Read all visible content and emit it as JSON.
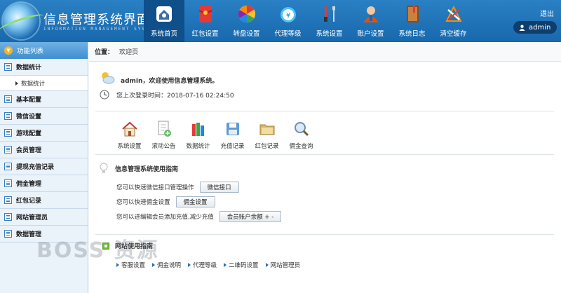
{
  "header": {
    "title": "信息管理系统界面",
    "subtitle": "INFORMATION MANAGEMENT SYSTEM GUI",
    "logout": "退出",
    "user": "admin",
    "nav": [
      {
        "label": "系统首页",
        "icon": "home-icon",
        "active": true
      },
      {
        "label": "红包设置",
        "icon": "red-envelope-icon",
        "active": false
      },
      {
        "label": "转盘设置",
        "icon": "wheel-icon",
        "active": false
      },
      {
        "label": "代理等级",
        "icon": "money-bag-icon",
        "active": false
      },
      {
        "label": "系统设置",
        "icon": "tools-icon",
        "active": false
      },
      {
        "label": "账户设置",
        "icon": "user-icon",
        "active": false
      },
      {
        "label": "系统日志",
        "icon": "book-icon",
        "active": false
      },
      {
        "label": "清空缓存",
        "icon": "cleanup-icon",
        "active": false
      }
    ]
  },
  "sidebar": {
    "header": "功能列表",
    "items": [
      {
        "label": "数据统计",
        "sub": [
          "数据统计"
        ]
      },
      {
        "label": "基本配置"
      },
      {
        "label": "微信设置"
      },
      {
        "label": "游戏配置"
      },
      {
        "label": "会员管理"
      },
      {
        "label": "提现充值记录"
      },
      {
        "label": "佣金管理"
      },
      {
        "label": "红包记录"
      },
      {
        "label": "网站管理员"
      },
      {
        "label": "数据管理"
      }
    ]
  },
  "breadcrumb": {
    "label": "位置：",
    "current": "欢迎页"
  },
  "welcome": {
    "text": "admin，欢迎使用信息管理系统。",
    "last_login": "您上次登录时间：2018-07-16 02:24:50"
  },
  "quick": [
    {
      "label": "系统设置"
    },
    {
      "label": "滚动公告"
    },
    {
      "label": "数据统计"
    },
    {
      "label": "充值记录"
    },
    {
      "label": "红包记录"
    },
    {
      "label": "佣金查询"
    }
  ],
  "guide": {
    "title": "信息管理系统使用指南",
    "rows": [
      {
        "text": "您可以快速微信接口管理操作",
        "button": "微信接口"
      },
      {
        "text": "您可以快速佣金设置",
        "button": "佣金设置"
      },
      {
        "text": "您可以进编辑会员添加充值,减少充值",
        "button": "会员账户余额 + -"
      }
    ]
  },
  "site": {
    "title": "网站使用指南",
    "links": [
      "客服设置",
      "佣金说明",
      "代理等级",
      "二维码设置",
      "网站管理员"
    ]
  },
  "watermark": "BOSS 资源",
  "colors": {
    "header": "#1a6db3",
    "active_nav": "#0f4f8a",
    "sidebar_bg": "#eaf2fa"
  }
}
